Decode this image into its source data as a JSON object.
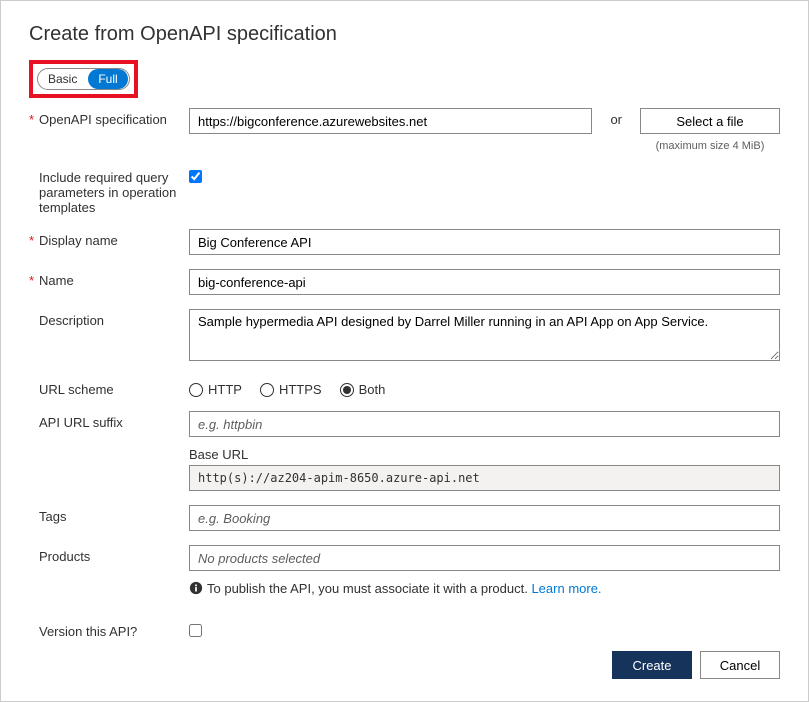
{
  "title": "Create from OpenAPI specification",
  "toggle": {
    "basic": "Basic",
    "full": "Full"
  },
  "labels": {
    "openapi_spec": "OpenAPI specification",
    "include_required": "Include required query parameters in operation templates",
    "display_name": "Display name",
    "name": "Name",
    "description": "Description",
    "url_scheme": "URL scheme",
    "api_url_suffix": "API URL suffix",
    "base_url": "Base URL",
    "tags": "Tags",
    "products": "Products",
    "version": "Version this API?"
  },
  "values": {
    "spec_url": "https://bigconference.azurewebsites.net",
    "display_name": "Big Conference API",
    "name": "big-conference-api",
    "description": "Sample hypermedia API designed by Darrel Miller running in an API App on App Service.",
    "base_url": "http(s)://az204-apim-8650.azure-api.net"
  },
  "placeholders": {
    "api_url_suffix": "e.g. httpbin",
    "tags": "e.g. Booking",
    "products": "No products selected"
  },
  "spec_file": {
    "or": "or",
    "button": "Select a file",
    "hint": "(maximum size 4 MiB)"
  },
  "url_scheme_opts": {
    "http": "HTTP",
    "https": "HTTPS",
    "both": "Both"
  },
  "info": {
    "text": "To publish the API, you must associate it with a product. ",
    "link": "Learn more."
  },
  "buttons": {
    "create": "Create",
    "cancel": "Cancel"
  }
}
